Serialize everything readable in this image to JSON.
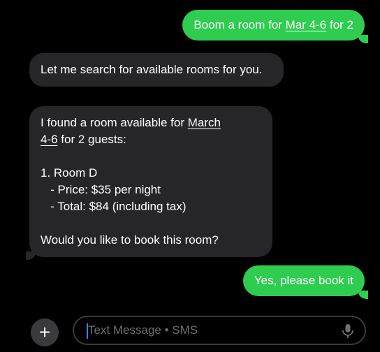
{
  "conversation": {
    "messages": [
      {
        "sender": "user",
        "text_before": "Boom a room for ",
        "link": "Mar 4-6",
        "text_after": " for 2"
      },
      {
        "sender": "assistant",
        "text": "Let me search for available rooms for you."
      },
      {
        "sender": "assistant",
        "line1_before": "I found a room available for ",
        "line1_link": "March",
        "line2_link": "4-6",
        "line2_after": " for 2 guests:",
        "item_title": "1. Room D",
        "price": "   - Price: $35 per night",
        "total": "   - Total: $84 (including tax)",
        "question": "Would you like to book this room?"
      },
      {
        "sender": "user",
        "text": "Yes, please book it"
      }
    ]
  },
  "composer": {
    "add_label": "+",
    "placeholder": "Text Message • SMS",
    "value": "",
    "mic_icon": "microphone-icon"
  },
  "colors": {
    "background": "#000000",
    "sent_bubble": "#2ecc4f",
    "received_bubble": "#262628",
    "cursor": "#3b82f6"
  }
}
